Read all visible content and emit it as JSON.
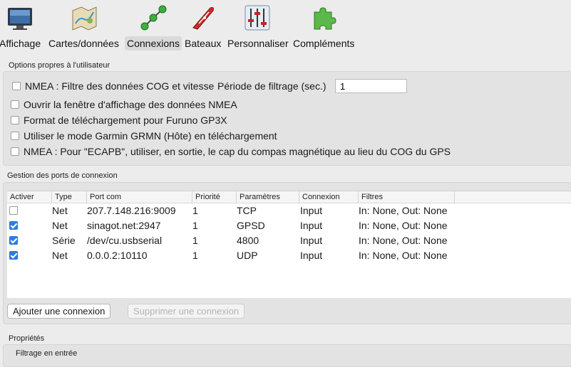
{
  "toolbar": {
    "items": [
      {
        "label": "Affichage",
        "icon": "monitor-icon"
      },
      {
        "label": "Cartes/données",
        "icon": "charts-icon"
      },
      {
        "label": "Connexions",
        "icon": "connections-icon",
        "selected": true
      },
      {
        "label": "Bateaux",
        "icon": "boat-icon"
      },
      {
        "label": "Personnaliser",
        "icon": "sliders-icon"
      },
      {
        "label": "Compléments",
        "icon": "puzzle-icon"
      }
    ]
  },
  "user_options": {
    "title": "Options propres à l'utilisateur",
    "nmea_filter_label": "NMEA : Filtre des données COG et vitesse",
    "filter_period_label": "Période de filtrage (sec.)",
    "filter_period_value": "1",
    "open_nmea_window_label": "Ouvrir la fenêtre d'affichage des données NMEA",
    "furuno_label": "Format de téléchargement pour Furuno GP3X",
    "garmin_label": "Utiliser le mode Garmin GRMN (Hôte) en téléchargement",
    "ecapb_label": "NMEA : Pour \"ECAPB\", utiliser, en sortie, le cap du compas magnétique  au lieu du COG du GPS"
  },
  "ports": {
    "title": "Gestion des ports de connexion",
    "columns": [
      "Activer",
      "Type",
      "Port com",
      "Priorité",
      "Paramètres",
      "Connexion",
      "Filtres"
    ],
    "rows": [
      {
        "enabled": false,
        "type": "Net",
        "port": "207.7.148.216:9009",
        "priority": "1",
        "params": "TCP",
        "connection": "Input",
        "filters": "In: None, Out: None"
      },
      {
        "enabled": true,
        "type": "Net",
        "port": "sinagot.net:2947",
        "priority": "1",
        "params": "GPSD",
        "connection": "Input",
        "filters": "In: None, Out: None"
      },
      {
        "enabled": true,
        "type": "Série",
        "port": "/dev/cu.usbserial",
        "priority": "1",
        "params": "4800",
        "connection": "Input",
        "filters": "In: None, Out: None"
      },
      {
        "enabled": true,
        "type": "Net",
        "port": "0.0.0.2:10110",
        "priority": "1",
        "params": "UDP",
        "connection": "Input",
        "filters": "In: None, Out: None"
      }
    ],
    "add_button": "Ajouter une connexion",
    "remove_button": "Supprimer une connexion"
  },
  "properties": {
    "title": "Propriétés",
    "input_filter_label": "Filtrage en entrée"
  },
  "colors": {
    "accent": "#2f7ce6",
    "background": "#ececec"
  }
}
